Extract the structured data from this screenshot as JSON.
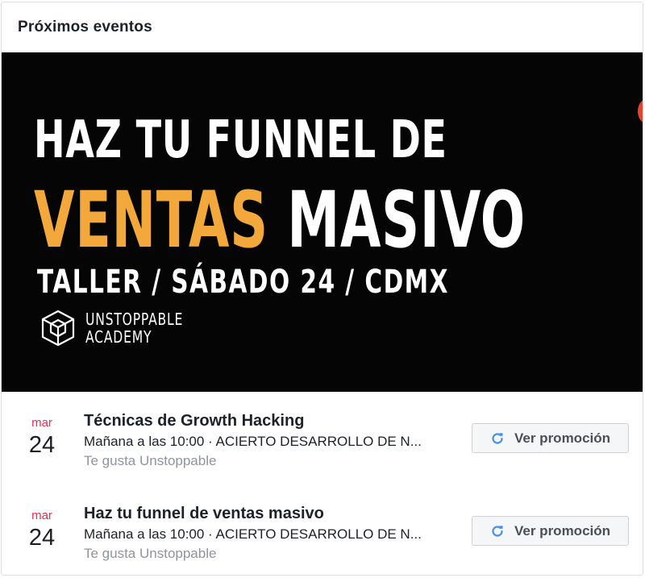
{
  "header": {
    "title": "Próximos eventos"
  },
  "banner": {
    "line1": "HAZ TU FUNNEL DE",
    "line2_accent": "VENTAS",
    "line2_rest": " MASIVO",
    "line3": "TALLER / SÁBADO 24 / CDMX",
    "brand_line1": "UNSTOPPABLE",
    "brand_line2": "ACADEMY",
    "accent_color": "#f2a83b",
    "background_color": "#050505",
    "logo_icon": "cube-outline-icon"
  },
  "events": [
    {
      "month": "mar",
      "day": "24",
      "title": "Técnicas de Growth Hacking",
      "meta": "Mañana a las 10:00 · ACIERTO DESARROLLO DE N...",
      "social": "Te gusta Unstoppable",
      "button_label": "Ver promoción",
      "button_icon": "refresh-icon"
    },
    {
      "month": "mar",
      "day": "24",
      "title": "Haz tu funnel de ventas masivo",
      "meta": "Mañana a las 10:00 · ACIERTO DESARROLLO DE N...",
      "social": "Te gusta Unstoppable",
      "button_label": "Ver promoción",
      "button_icon": "refresh-icon"
    }
  ],
  "colors": {
    "month": "#f02849",
    "button_icon": "#4a90e2"
  }
}
